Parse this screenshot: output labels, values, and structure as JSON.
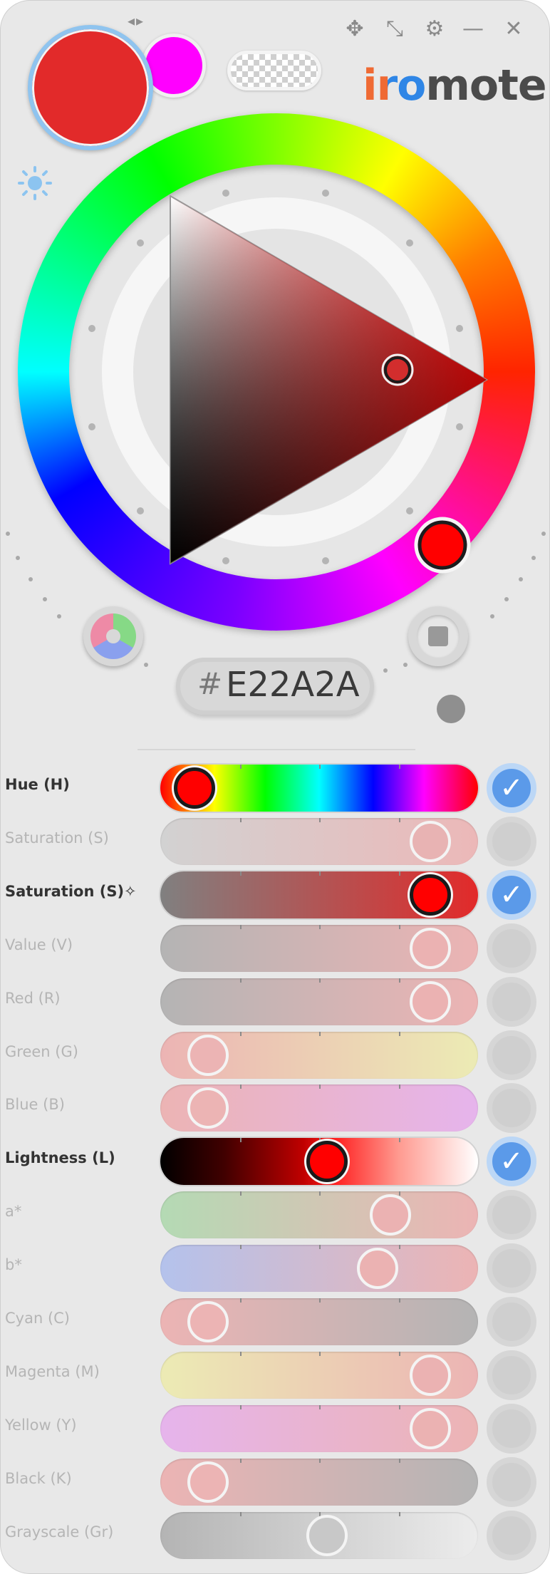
{
  "app": {
    "logo": {
      "part1": "iro",
      "part2": "mote",
      "color1": "#ef6a34",
      "color2": "#2f86e6",
      "color3": "#4b4b4b"
    },
    "window_controls": {
      "move": "✥",
      "resize": "⤡",
      "settings": "⚙",
      "minimize": "—",
      "close": "✕"
    },
    "swap_icon": "◂▸"
  },
  "colors": {
    "current": "#e22a2a",
    "previous": "#ff00ff",
    "accent_check": "#5b9ae9"
  },
  "hex": {
    "hash": "#",
    "value": "E22A2A"
  },
  "sliders": [
    {
      "id": "hue",
      "label": "Hue (H)",
      "active": true,
      "checked": true,
      "value": 0.03,
      "gradient": "linear-gradient(90deg,#ff0000 0%,#ffff00 17%,#00ff00 33%,#00ffff 50%,#0000ff 67%,#ff00ff 83%,#ff0000 100%)",
      "knob": "#ff0000"
    },
    {
      "id": "saturation",
      "label": "Saturation (S)",
      "active": false,
      "checked": false,
      "value": 0.92,
      "gradient": "linear-gradient(90deg,#d2d2d2 0%,#ecb8b8 100%)",
      "knob": "#e8b3b3"
    },
    {
      "id": "saturation-star",
      "label": "Saturation (S)✧",
      "active": true,
      "checked": true,
      "value": 0.92,
      "gradient": "linear-gradient(90deg,#808080 0%,#e22a2a 100%)",
      "knob": "#ff0000"
    },
    {
      "id": "value",
      "label": "Value (V)",
      "active": false,
      "checked": false,
      "value": 0.92,
      "gradient": "linear-gradient(90deg,#b4b4b4 0%,#ecb4b4 100%)",
      "knob": "#ebb2b2"
    },
    {
      "id": "red",
      "label": "Red (R)",
      "active": false,
      "checked": false,
      "value": 0.92,
      "gradient": "linear-gradient(90deg,#b4b4b4 0%,#ecb4b4 100%)",
      "knob": "#ebb2b2"
    },
    {
      "id": "green",
      "label": "Green (G)",
      "active": false,
      "checked": false,
      "value": 0.08,
      "gradient": "linear-gradient(90deg,#ecb4b4 0%,#ecebb4 100%)",
      "knob": "#ecb4b4"
    },
    {
      "id": "blue",
      "label": "Blue (B)",
      "active": false,
      "checked": false,
      "value": 0.08,
      "gradient": "linear-gradient(90deg,#ecb4b4 0%,#e6b4ec 100%)",
      "knob": "#ecb4b4"
    },
    {
      "id": "lightness",
      "label": "Lightness (L)",
      "active": true,
      "checked": true,
      "value": 0.53,
      "gradient": "linear-gradient(90deg,#000000 0%,#400000 20%,#c00000 45%,#ff2020 55%,#ff9a90 75%,#ffffff 100%)",
      "knob": "#ff0000"
    },
    {
      "id": "a-star",
      "label": "a*",
      "active": false,
      "checked": false,
      "value": 0.77,
      "gradient": "linear-gradient(90deg,#b4dab4 0%,#ecb4b4 100%)",
      "knob": "#ebb2b2"
    },
    {
      "id": "b-star",
      "label": "b*",
      "active": false,
      "checked": false,
      "value": 0.72,
      "gradient": "linear-gradient(90deg,#b4c2ec 0%,#ecb4b4 100%)",
      "knob": "#ebb2b2"
    },
    {
      "id": "cyan",
      "label": "Cyan (C)",
      "active": false,
      "checked": false,
      "value": 0.08,
      "gradient": "linear-gradient(90deg,#ecb4b4 0%,#b4b4b4 100%)",
      "knob": "#ecb4b4"
    },
    {
      "id": "magenta",
      "label": "Magenta (M)",
      "active": false,
      "checked": false,
      "value": 0.92,
      "gradient": "linear-gradient(90deg,#ecebb4 0%,#ecb4b4 100%)",
      "knob": "#ebb2b2"
    },
    {
      "id": "yellow",
      "label": "Yellow (Y)",
      "active": false,
      "checked": false,
      "value": 0.92,
      "gradient": "linear-gradient(90deg,#e6b4ec 0%,#ecb4b4 100%)",
      "knob": "#ebb2b2"
    },
    {
      "id": "black",
      "label": "Black (K)",
      "active": false,
      "checked": false,
      "value": 0.08,
      "gradient": "linear-gradient(90deg,#ecb4b4 0%,#b4b4b4 100%)",
      "knob": "#ecb4b4"
    },
    {
      "id": "grayscale",
      "label": "Grayscale (Gr)",
      "active": false,
      "checked": false,
      "value": 0.53,
      "gradient": "linear-gradient(90deg,#b4b4b4 0%,#ececec 100%)",
      "knob": "#c8c8c8"
    }
  ]
}
